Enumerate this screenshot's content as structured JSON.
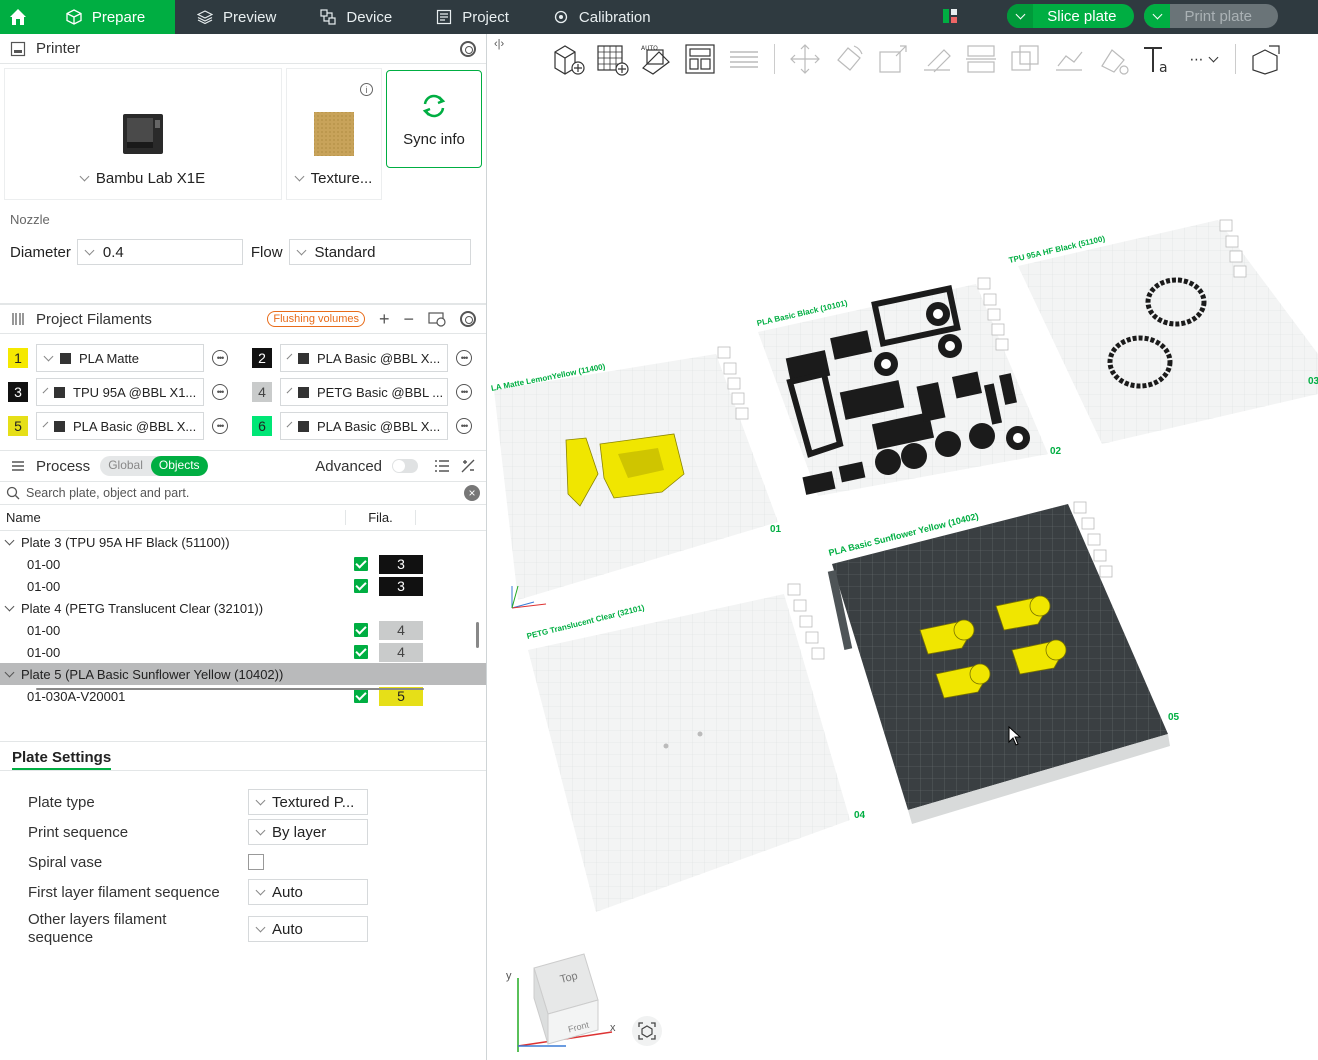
{
  "topbar": {
    "tabs": [
      {
        "label": "Prepare",
        "icon": "cube-icon",
        "active": true
      },
      {
        "label": "Preview",
        "icon": "layers-icon",
        "active": false
      },
      {
        "label": "Device",
        "icon": "device-icon",
        "active": false
      },
      {
        "label": "Project",
        "icon": "project-icon",
        "active": false
      },
      {
        "label": "Calibration",
        "icon": "calibration-icon",
        "active": false
      }
    ],
    "slice_label": "Slice plate",
    "print_label": "Print plate",
    "accent": "#00ae42"
  },
  "printer": {
    "section_title": "Printer",
    "model": "Bambu Lab X1E",
    "plate": "Texture...",
    "sync_label": "Sync info",
    "nozzle_title": "Nozzle",
    "diameter_label": "Diameter",
    "diameter_value": "0.4",
    "flow_label": "Flow",
    "flow_value": "Standard"
  },
  "filaments": {
    "section_title": "Project Filaments",
    "flushing_label": "Flushing volumes",
    "items": [
      {
        "num": "1",
        "name": "PLA Matte",
        "color": "#f5e900",
        "text": "#222"
      },
      {
        "num": "2",
        "name": "PLA Basic @BBL X...",
        "color": "#111111",
        "text": "#fff"
      },
      {
        "num": "3",
        "name": "TPU 95A @BBL X1...",
        "color": "#111111",
        "text": "#fff"
      },
      {
        "num": "4",
        "name": "PETG Basic @BBL ...",
        "color": "#c9cbcb",
        "text": "#444"
      },
      {
        "num": "5",
        "name": "PLA Basic @BBL X...",
        "color": "#e6df18",
        "text": "#222"
      },
      {
        "num": "6",
        "name": "PLA Basic @BBL X...",
        "color": "#00e676",
        "text": "#222"
      }
    ]
  },
  "process": {
    "section_title": "Process",
    "global_label": "Global",
    "objects_label": "Objects",
    "advanced_label": "Advanced",
    "search_placeholder": "Search plate, object and part.",
    "col_name": "Name",
    "col_fila": "Fila.",
    "rows": [
      {
        "type": "plate",
        "label": "Plate 3 (TPU 95A HF Black (51100))",
        "selected": false
      },
      {
        "type": "obj",
        "label": "01-00",
        "fila": "3",
        "fila_color": "#111111",
        "fila_text": "#fff"
      },
      {
        "type": "obj",
        "label": "01-00",
        "fila": "3",
        "fila_color": "#111111",
        "fila_text": "#fff"
      },
      {
        "type": "plate",
        "label": "Plate 4 (PETG Translucent Clear (32101))",
        "selected": false
      },
      {
        "type": "obj",
        "label": "01-00",
        "fila": "4",
        "fila_color": "#c9cbcb",
        "fila_text": "#444"
      },
      {
        "type": "obj",
        "label": "01-00",
        "fila": "4",
        "fila_color": "#c9cbcb",
        "fila_text": "#444"
      },
      {
        "type": "plate",
        "label": "Plate 5 (PLA Basic Sunflower Yellow (10402))",
        "selected": true
      },
      {
        "type": "obj",
        "label": "01-030A-V20001",
        "fila": "5",
        "fila_color": "#e6df18",
        "fila_text": "#222"
      }
    ]
  },
  "plate_settings": {
    "tab_label": "Plate Settings",
    "plate_type_label": "Plate type",
    "plate_type_value": "Textured P...",
    "print_sequence_label": "Print sequence",
    "print_sequence_value": "By layer",
    "spiral_vase_label": "Spiral vase",
    "first_layer_label": "First layer filament sequence",
    "first_layer_value": "Auto",
    "other_layers_label": "Other layers filament sequence",
    "other_layers_value": "Auto"
  },
  "canvas": {
    "plates": [
      {
        "label": "LA Matte LemonYellow (11400)",
        "num": "01"
      },
      {
        "label": "PLA Basic Black (10101)",
        "num": "02"
      },
      {
        "label": "TPU 95A HF Black (51100)",
        "num": "03"
      },
      {
        "label": "PETG Translucent Clear (32101)",
        "num": "04"
      },
      {
        "label": "PLA Basic Sunflower Yellow (10402)",
        "num": "05"
      }
    ],
    "viewcube_top": "Top",
    "viewcube_front": "Front",
    "axis_x": "x",
    "axis_y": "y"
  }
}
